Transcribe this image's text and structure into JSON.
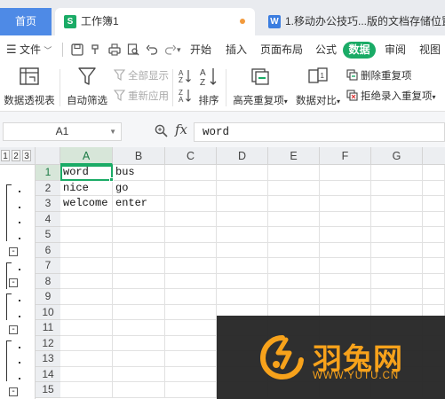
{
  "tabs": {
    "home": "首页",
    "workbook": "工作簿1",
    "workbook_icon": "S",
    "doc": "1.移动办公技巧...版的文档存储位置",
    "doc_icon": "W"
  },
  "menu": {
    "file": "文件",
    "items": [
      "开始",
      "插入",
      "页面布局",
      "公式",
      "数据",
      "审阅",
      "视图"
    ],
    "active": "数据"
  },
  "ribbon": {
    "pivot": "数据透视表",
    "autofilter": "自动筛选",
    "show_all": "全部显示",
    "reapply": "重新应用",
    "sort": "排序",
    "highlight_dup": "高亮重复项",
    "compare": "数据对比",
    "remove_dup": "删除重复项",
    "reject_dup": "拒绝录入重复项"
  },
  "formula_bar": {
    "name_box": "A1",
    "fx": "fx",
    "value": "word"
  },
  "sheet": {
    "outline_levels": [
      "1",
      "2",
      "3"
    ],
    "columns": [
      "A",
      "B",
      "C",
      "D",
      "E",
      "F",
      "G"
    ],
    "rows": [
      "1",
      "2",
      "3",
      "4",
      "5",
      "6",
      "7",
      "8",
      "9",
      "10",
      "11",
      "12",
      "13",
      "14",
      "15"
    ],
    "cells": [
      [
        "word",
        "bus"
      ],
      [
        "nice",
        "go"
      ],
      [
        "welcome",
        "enter"
      ]
    ]
  },
  "watermark": {
    "brand": "羽兔网",
    "url": "WWW.YUTU.CN"
  },
  "colors": {
    "accent_green": "#1aab66",
    "home_tab_blue": "#4e8ae6",
    "watermark_orange": "#f7a21b"
  }
}
